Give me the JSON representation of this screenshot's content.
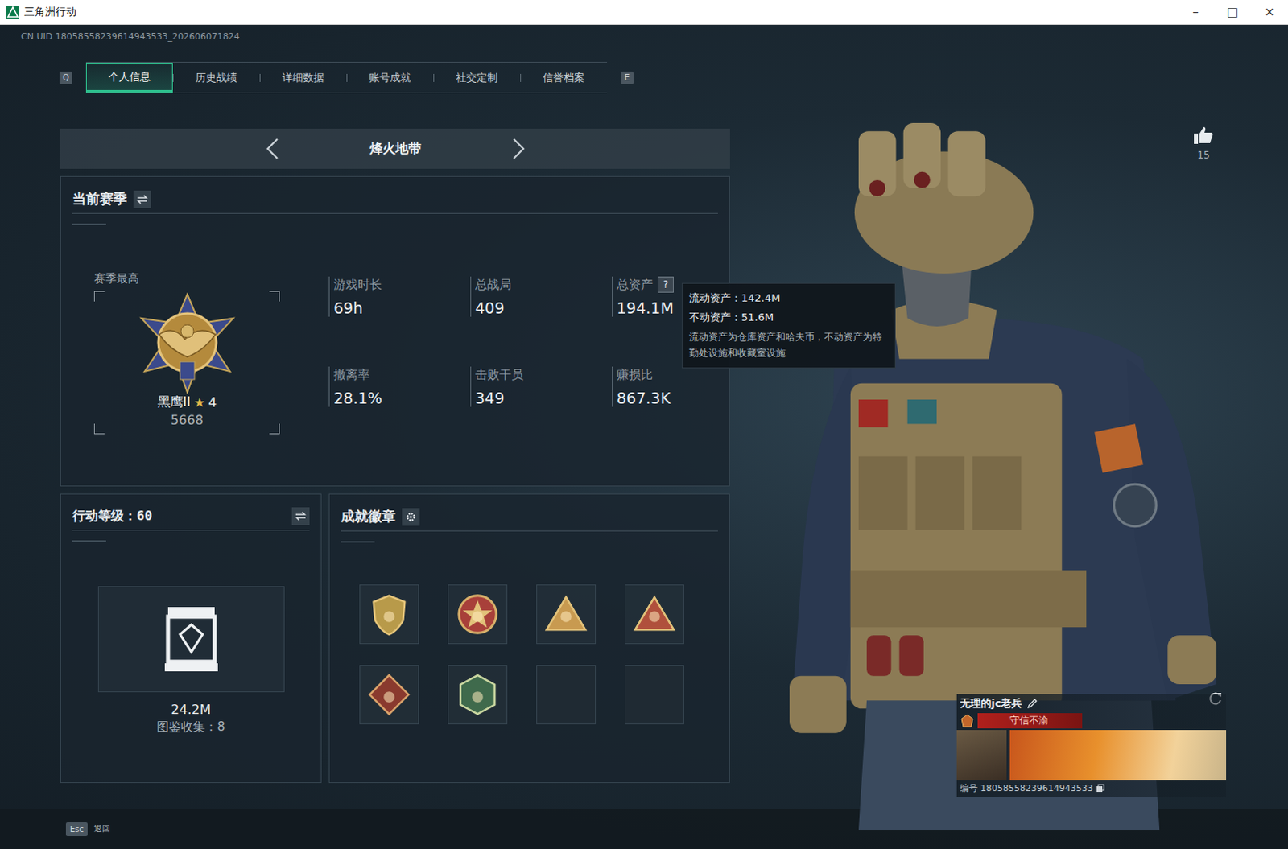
{
  "window": {
    "title": "三角洲行动",
    "controls": [
      "–",
      "□",
      "×"
    ]
  },
  "uid": "CN UID 18058558239614943533_202606071824",
  "tabs": {
    "prev_key": "Q",
    "next_key": "E",
    "items": [
      {
        "label": "个人信息",
        "selected": true
      },
      {
        "label": "历史战绩",
        "selected": false
      },
      {
        "label": "详细数据",
        "selected": false
      },
      {
        "label": "账号成就",
        "selected": false
      },
      {
        "label": "社交定制",
        "selected": false
      },
      {
        "label": "信誉档案",
        "selected": false
      }
    ]
  },
  "mode": {
    "label": "烽火地带"
  },
  "season": {
    "title": "当前赛季",
    "best_label": "赛季最高",
    "rank": "黑鹰II",
    "rank_star": "★",
    "rank_stars": "4",
    "score": "5668",
    "stats": [
      {
        "label": "游戏时长",
        "value": "69h",
        "help": ""
      },
      {
        "label": "总战局",
        "value": "409",
        "help": ""
      },
      {
        "label": "总资产",
        "value": "194.1M",
        "help": "?"
      },
      {
        "label": "撤离率",
        "value": "28.1%",
        "help": ""
      },
      {
        "label": "击败干员",
        "value": "349",
        "help": ""
      },
      {
        "label": "赚损比",
        "value": "867.3K",
        "help": ""
      }
    ]
  },
  "tooltip": {
    "lines": [
      "流动资产：142.4M",
      "不动资产：51.6M"
    ],
    "note": "流动资产为仓库资产和哈夫币，不动资产为特勤处设施和收藏室设施"
  },
  "level_panel": {
    "title": "行动等级：60",
    "value": "24.2M",
    "collection": "图鉴收集：8"
  },
  "badges": {
    "title": "成就徽章",
    "slots": [
      {
        "kind": "shield",
        "color": "#b89a4a"
      },
      {
        "kind": "star",
        "color": "#a8403a"
      },
      {
        "kind": "triangle",
        "color": "#c89a50"
      },
      {
        "kind": "triangle",
        "color": "#b0503c"
      },
      {
        "kind": "diamond",
        "color": "#8a3a2e"
      },
      {
        "kind": "hexagon",
        "color": "#3f6a4c"
      },
      {
        "kind": "empty",
        "color": "#1f2a33"
      },
      {
        "kind": "empty",
        "color": "#1f2a33"
      }
    ]
  },
  "like": {
    "count": "15"
  },
  "player": {
    "name": "无理的jc老兵",
    "title": "守信不渝",
    "id": "编号 18058558239614943533"
  },
  "footer": {
    "key": "Esc",
    "label": "返回"
  }
}
